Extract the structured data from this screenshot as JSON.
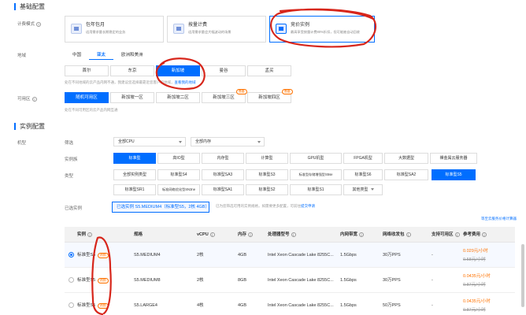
{
  "basic": {
    "title": "基础配置",
    "billing_label": "计费模式",
    "billing_cards": [
      {
        "title": "包年包月",
        "desc": "适用需求量长期稳定的业务"
      },
      {
        "title": "按量计费",
        "desc": "适用需求量会大幅波动的场景"
      },
      {
        "title": "竞价实例",
        "desc": "最高享受按量计费80%折扣，但可能被自动回收"
      }
    ],
    "region_label": "地域",
    "region_tabs": [
      "中国",
      "亚太",
      "欧洲和美洲"
    ],
    "regions": [
      "首尔",
      "东京",
      "新加坡",
      "曼谷",
      "孟买"
    ],
    "region_note_a": "处在不同地域的云产品内网不通，我建议您选择最靠近您客户的地域，",
    "region_note_link": "查看我的地域",
    "zone_label": "可用区",
    "zones": [
      "随机可用区",
      "新加坡一区",
      "新加坡二区",
      "新加坡三区",
      "新加坡四区"
    ],
    "zone_badges": [
      "售罄",
      "售罄"
    ],
    "zone_note": "处在不同可用区的云产品内网互通"
  },
  "instance": {
    "title": "实例配置",
    "model_label": "机型",
    "filter_label": "筛选",
    "cpu_select": "全部CPU",
    "mem_select": "全部内存",
    "family_label": "实例族",
    "families": [
      "标准型",
      "高IO型",
      "内存型",
      "计算型",
      "GPU机型",
      "FPGA机型",
      "大数据型",
      "裸金属云服务器"
    ],
    "type_label": "类型",
    "types_row1": [
      "全部实例类型",
      "标准型S4",
      "标准型SA3",
      "标准型S3",
      "标准型存储增强型S5se",
      "标准型S6",
      "标准型SA2",
      "标准型S5"
    ],
    "types_row2": [
      "标准型SR1",
      "标准网络优化型SN3ne",
      "标准型SA1",
      "标准型S2",
      "标准型S1",
      "其他类型"
    ],
    "chosen_label": "已选实例",
    "chosen_value": "已选实例 S5.MEDIUM4（标准型S5，2核 4GB）",
    "chosen_note_a": "已为您筛选可用的实例规格，如需要更多配置，可前往",
    "chosen_note_link": "提交申请",
    "price_link": "等至云服务价格计算器",
    "table": {
      "headers": [
        "实例",
        "规格",
        "vCPU",
        "内存",
        "处理器型号",
        "内网带宽",
        "网络收发包",
        "支持可用区",
        "参考费用"
      ],
      "rows": [
        {
          "name": "标准型S5",
          "badge": "热销",
          "spec": "S5.MEDIUM4",
          "vcpu": "2核",
          "mem": "4GB",
          "cpu": "Intel Xeon Cascade Lake 8255C...",
          "bw": "1.5Gbps",
          "pps": "30万PPS",
          "zone": "-",
          "price": "0.029元/小时",
          "old": "0.58元/小时"
        },
        {
          "name": "标准型S5",
          "badge": "热销",
          "spec": "S5.MEDIUM8",
          "vcpu": "2核",
          "mem": "8GB",
          "cpu": "Intel Xeon Cascade Lake 8255C...",
          "bw": "1.5Gbps",
          "pps": "30万PPS",
          "zone": "-",
          "price": "0.0435元/小时",
          "old": "0.87元/小时"
        },
        {
          "name": "标准型S5",
          "badge": "热销",
          "spec": "S5.LARGE4",
          "vcpu": "4核",
          "mem": "4GB",
          "cpu": "Intel Xeon Cascade Lake 8255C...",
          "bw": "1.5Gbps",
          "pps": "50万PPS",
          "zone": "-",
          "price": "0.0435元/小时",
          "old": "0.87元/小时"
        }
      ]
    }
  },
  "colors": {
    "accent": "#006eff",
    "annotation": "#d7261b",
    "warning": "#ff7200"
  }
}
